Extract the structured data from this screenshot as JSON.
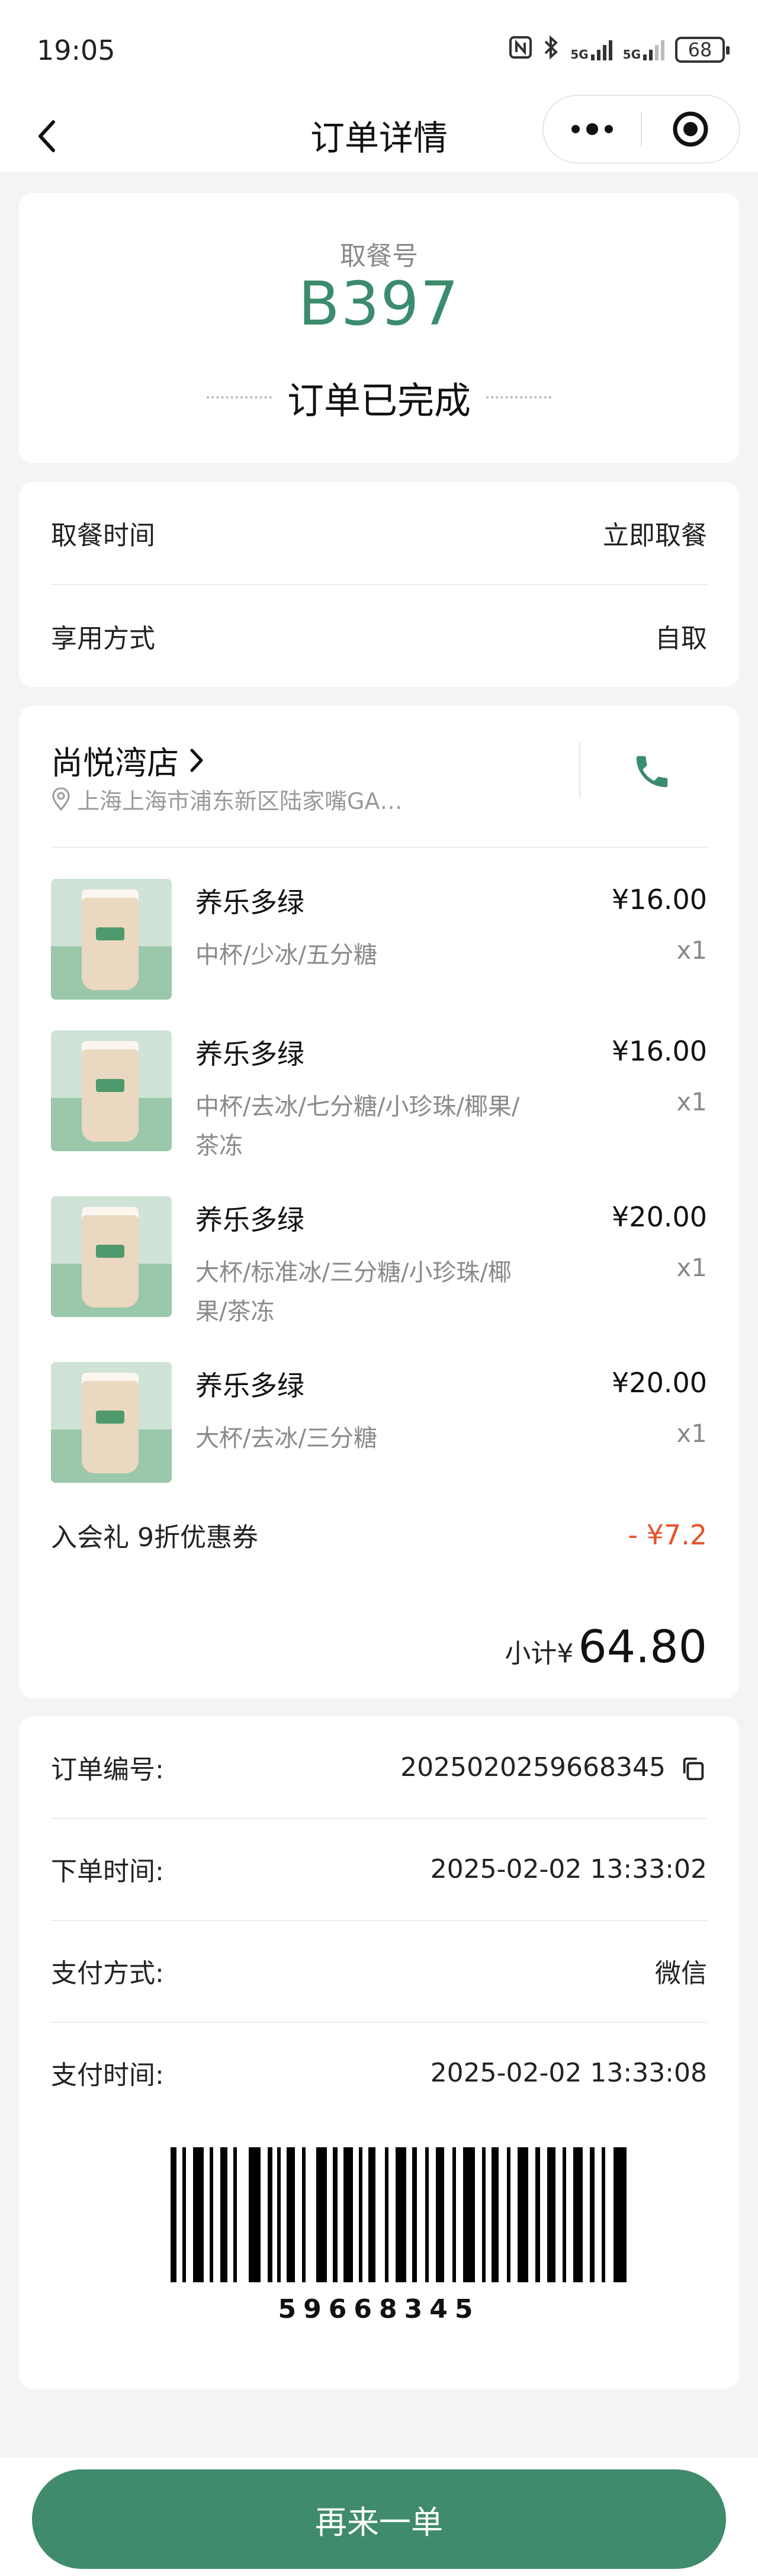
{
  "status_bar": {
    "time": "19:05",
    "network_1": "5G",
    "network_2": "5G",
    "battery": "68"
  },
  "navbar": {
    "title": "订单详情",
    "back_icon": "chevron-left-icon",
    "more_icon": "more-dots-icon",
    "target_icon": "target-icon"
  },
  "pickup": {
    "label": "取餐号",
    "number": "B397",
    "status": "订单已完成"
  },
  "info": {
    "rows": [
      {
        "label": "取餐时间",
        "value": "立即取餐"
      },
      {
        "label": "享用方式",
        "value": "自取"
      }
    ]
  },
  "store": {
    "name": "尚悦湾店",
    "address": "上海上海市浦东新区陆家嘴GA…",
    "phone_icon": "phone-icon"
  },
  "items": [
    {
      "name": "养乐多绿",
      "spec": "中杯/少冰/五分糖",
      "price": "¥16.00",
      "qty": "x1"
    },
    {
      "name": "养乐多绿",
      "spec": "中杯/去冰/七分糖/小珍珠/椰果/茶冻",
      "price": "¥16.00",
      "qty": "x1"
    },
    {
      "name": "养乐多绿",
      "spec": "大杯/标准冰/三分糖/小珍珠/椰果/茶冻",
      "price": "¥20.00",
      "qty": "x1"
    },
    {
      "name": "养乐多绿",
      "spec": "大杯/去冰/三分糖",
      "price": "¥20.00",
      "qty": "x1"
    }
  ],
  "coupon": {
    "label": "入会礼 9折优惠券",
    "value": "- ¥7.2"
  },
  "subtotal": {
    "label": "小计¥",
    "value": "64.80"
  },
  "order_meta": {
    "rows": [
      {
        "label": "订单编号:",
        "value": "2025020259668345"
      },
      {
        "label": "下单时间:",
        "value": "2025-02-02 13:33:02"
      },
      {
        "label": "支付方式:",
        "value": "微信"
      },
      {
        "label": "支付时间:",
        "value": "2025-02-02 13:33:08"
      }
    ],
    "barcode_number": "59668345"
  },
  "footer": {
    "reorder_label": "再来一单"
  },
  "colors": {
    "accent": "#3f8b6b",
    "pickup_green": "#3b8b6d",
    "discount_red": "#e6522c"
  }
}
